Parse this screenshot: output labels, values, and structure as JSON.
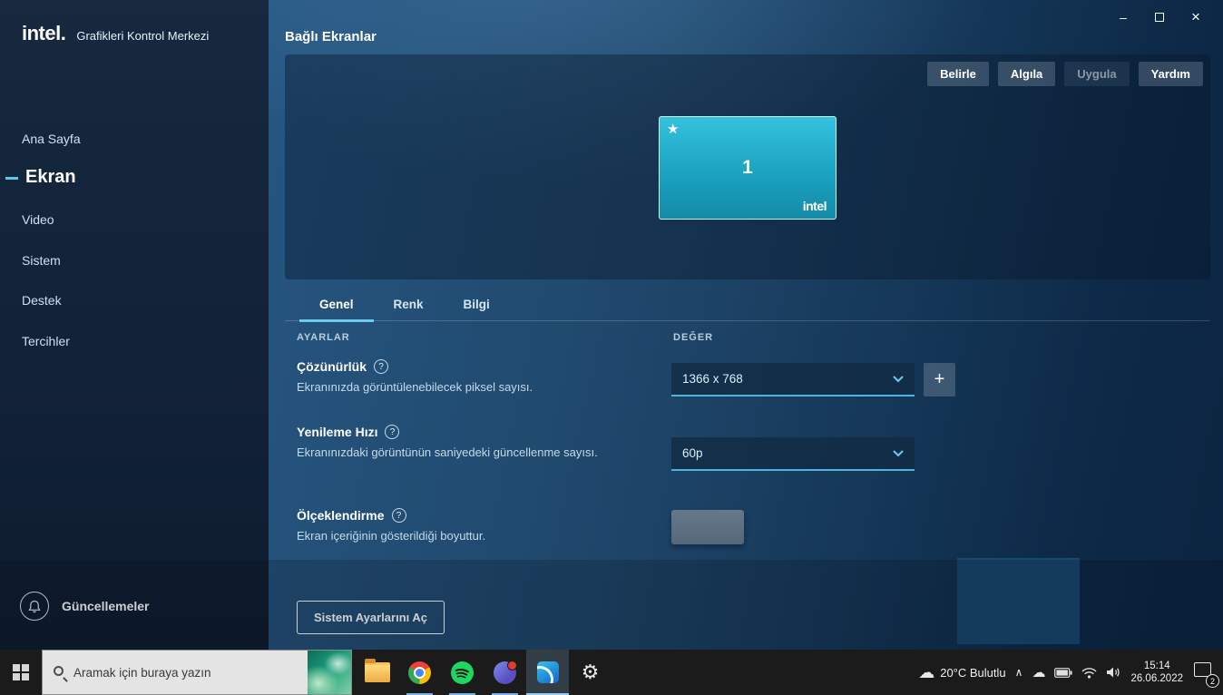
{
  "window": {
    "minimize": "–",
    "close": "×"
  },
  "colors": {
    "accent": "#5fc8ea",
    "sidebar_bg": "#142740",
    "main_bg_top": "#265681",
    "main_bg_bottom": "#0b2440",
    "display_teal": "#2fc0dc",
    "taskbar_bg": "#1b1b1b",
    "spotify_green": "#1ed760",
    "chrome_blue": "#4285f4"
  },
  "icons": {
    "star": "★",
    "plus": "+",
    "settings_gear": "⚙",
    "cloud": "☁",
    "chevron_up": "∧",
    "named_shapes": [
      "bell-icon",
      "help-icon",
      "chevron-down-icon",
      "search-icon",
      "windows-logo-icon",
      "folder-icon",
      "chrome-icon",
      "spotify-icon",
      "cs-app-icon",
      "intel-gcc-icon",
      "battery-icon",
      "network-icon",
      "volume-icon",
      "action-center-icon"
    ]
  },
  "sidebar": {
    "logo": "intel.",
    "app_title": "Grafikleri Kontrol Merkezi",
    "items": [
      {
        "label": "Ana Sayfa",
        "active": false
      },
      {
        "label": "Ekran",
        "active": true
      },
      {
        "label": "Video",
        "active": false
      },
      {
        "label": "Sistem",
        "active": false
      },
      {
        "label": "Destek",
        "active": false
      },
      {
        "label": "Tercihler",
        "active": false
      }
    ],
    "updates_label": "Güncellemeler"
  },
  "main": {
    "title": "Bağlı Ekranlar",
    "preview": {
      "buttons": [
        {
          "label": "Belirle",
          "disabled": false
        },
        {
          "label": "Algıla",
          "disabled": false
        },
        {
          "label": "Uygula",
          "disabled": true
        },
        {
          "label": "Yardım",
          "disabled": false
        }
      ],
      "display": {
        "number": "1",
        "brand": "intel",
        "starred": true
      }
    },
    "tabs": [
      {
        "label": "Genel",
        "active": true
      },
      {
        "label": "Renk",
        "active": false
      },
      {
        "label": "Bilgi",
        "active": false
      }
    ],
    "columns": {
      "settings": "AYARLAR",
      "value": "DEĞER"
    },
    "settings": [
      {
        "name": "Çözünürlük",
        "description": "Ekranınızda görüntülenebilecek piksel sayısı.",
        "value": "1366 x 768"
      },
      {
        "name": "Yenileme Hızı",
        "description": "Ekranınızdaki görüntünün saniyedeki güncellenme sayısı.",
        "value": "60p"
      },
      {
        "name": "Ölçeklendirme",
        "description": "Ekran içeriğinin gösterildiği boyuttur.",
        "value": ""
      }
    ],
    "system_settings_button": "Sistem Ayarlarını Aç"
  },
  "taskbar": {
    "search_placeholder": "Aramak için buraya yazın",
    "tray": {
      "weather": "20°C Bulutlu",
      "time": "15:14",
      "date": "26.06.2022",
      "notification_count": "2"
    }
  }
}
